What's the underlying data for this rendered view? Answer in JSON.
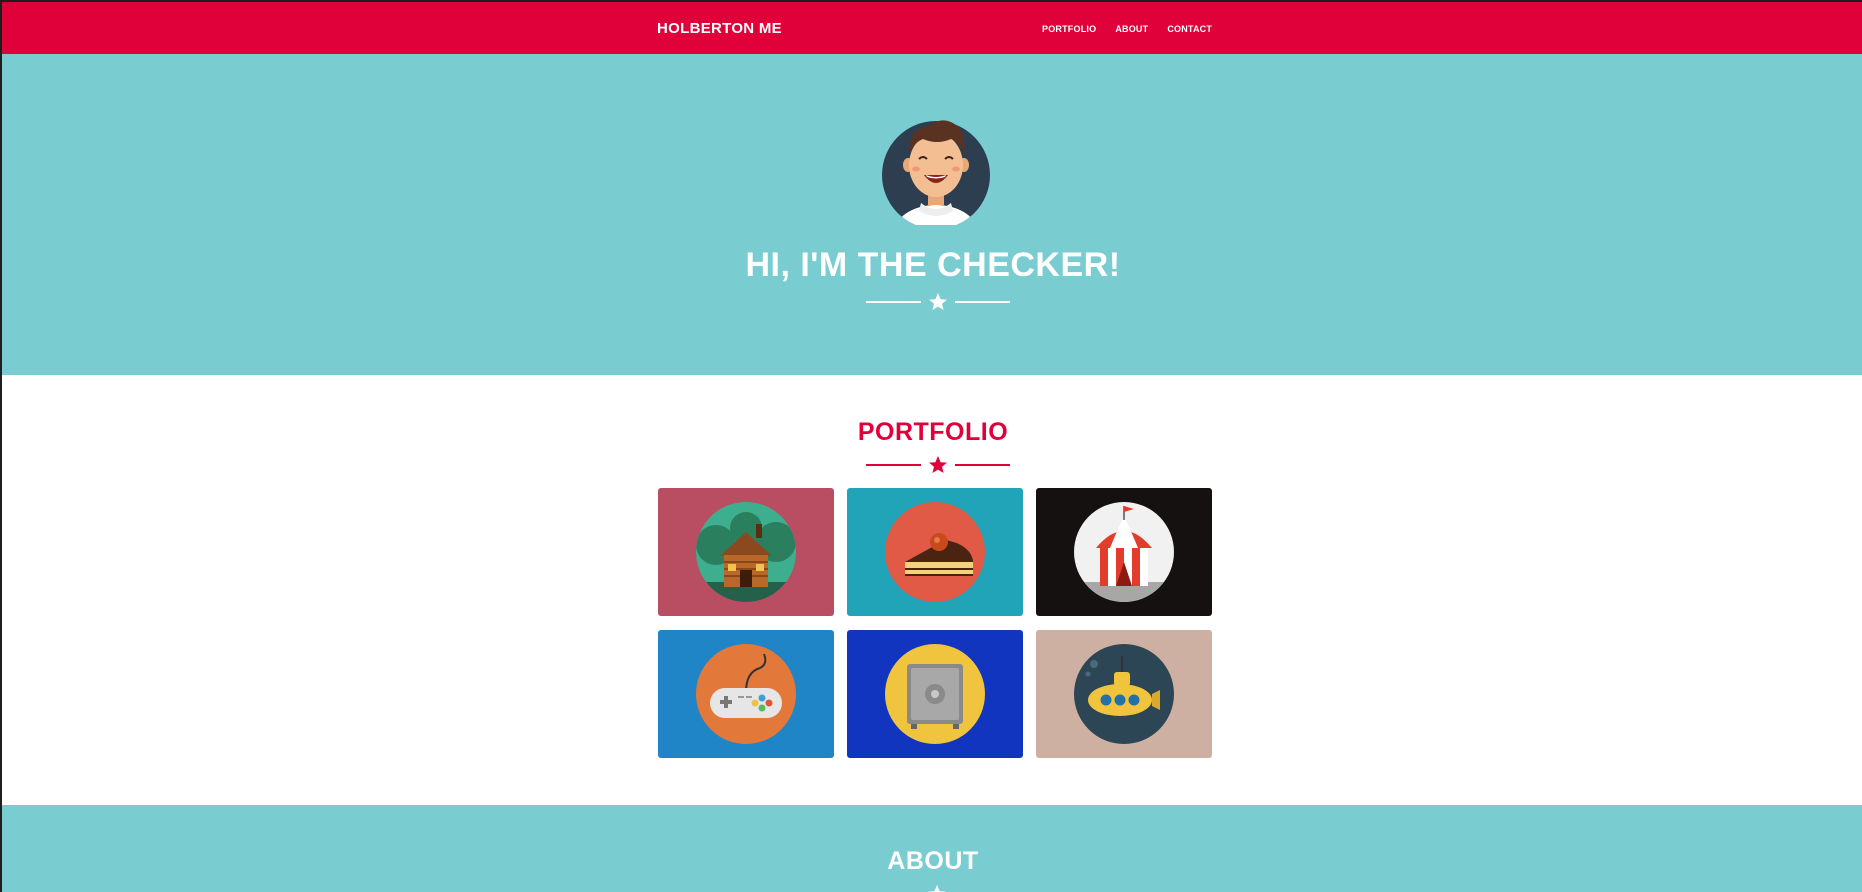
{
  "navbar": {
    "brand": "HOLBERTON ME",
    "links": [
      "PORTFOLIO",
      "ABOUT",
      "CONTACT"
    ]
  },
  "hero": {
    "title": "HI, I'M THE CHECKER!",
    "avatar_icon": "smiling-person-avatar-icon"
  },
  "portfolio": {
    "title": "PORTFOLIO",
    "items": [
      {
        "icon": "log-cabin-icon",
        "bg": "#b94e63"
      },
      {
        "icon": "cake-slice-icon",
        "bg": "#21a4b8"
      },
      {
        "icon": "circus-tent-icon",
        "bg": "#161111"
      },
      {
        "icon": "game-controller-icon",
        "bg": "#2085c6"
      },
      {
        "icon": "safe-icon",
        "bg": "#1235bf"
      },
      {
        "icon": "submarine-icon",
        "bg": "#cdb0a2"
      }
    ]
  },
  "about": {
    "title": "ABOUT"
  },
  "colors": {
    "accent": "#e0013a",
    "hero_bg": "#79cdd1",
    "white": "#ffffff"
  }
}
